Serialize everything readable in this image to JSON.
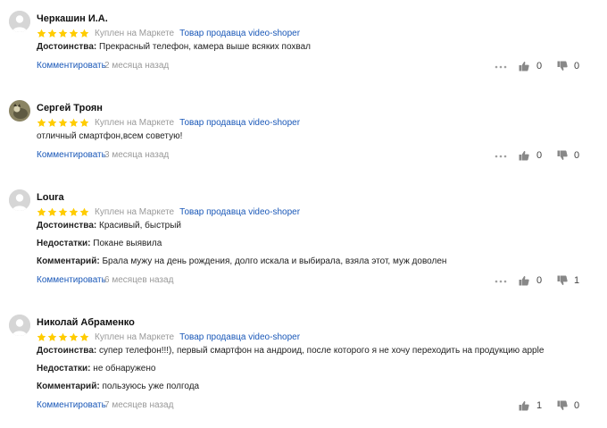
{
  "reviews": [
    {
      "author": "Черкашин И.А.",
      "purchase": "Куплен на Маркете",
      "seller": "Товар продавца video-shoper",
      "rating": 5,
      "lines": [
        {
          "label": "Достоинства:",
          "text": "Прекрасный телефон, камера выше всяких похвал"
        }
      ],
      "comment_link": "Комментировать",
      "date": "2 месяца назад",
      "likes": "0",
      "dislikes": "0"
    },
    {
      "author": "Сергей Троян",
      "purchase": "Куплен на Маркете",
      "seller": "Товар продавца video-shoper",
      "rating": 5,
      "lines": [
        {
          "label": "",
          "text": "отличный смартфон,всем советую!"
        }
      ],
      "comment_link": "Комментировать",
      "date": "3 месяца назад",
      "likes": "0",
      "dislikes": "0"
    },
    {
      "author": "Loura",
      "purchase": "Куплен на Маркете",
      "seller": "Товар продавца video-shoper",
      "rating": 5,
      "lines": [
        {
          "label": "Достоинства:",
          "text": "Красивый, быстрый"
        },
        {
          "label": "Недостатки:",
          "text": "Покане выявила"
        },
        {
          "label": "Комментарий:",
          "text": "Брала мужу на день рождения, долго искала и выбирала, взяла этот, муж доволен"
        }
      ],
      "comment_link": "Комментировать",
      "date": "6 месяцев назад",
      "likes": "0",
      "dislikes": "1"
    },
    {
      "author": "Николай Абраменко",
      "purchase": "Куплен на Маркете",
      "seller": "Товар продавца video-shoper",
      "rating": 5,
      "lines": [
        {
          "label": "Достоинства:",
          "text": "супер телефон!!!), первый смартфон на андроид, после которого я не хочу переходить на продукцию apple"
        },
        {
          "label": "Недостатки:",
          "text": "не обнаружено"
        },
        {
          "label": "Комментарий:",
          "text": "пользуюсь уже полгода"
        }
      ],
      "comment_link": "Комментировать",
      "date": "7 месяцев назад",
      "likes": "1",
      "dislikes": "0"
    }
  ],
  "icons": {
    "star": "star-icon",
    "more": "more-dots-icon",
    "like": "thumb-up-icon",
    "dislike": "thumb-down-icon",
    "avatar": "user-avatar-icon"
  },
  "colors": {
    "star": "#ffcc00",
    "link": "#1a58b8",
    "muted": "#999999"
  }
}
